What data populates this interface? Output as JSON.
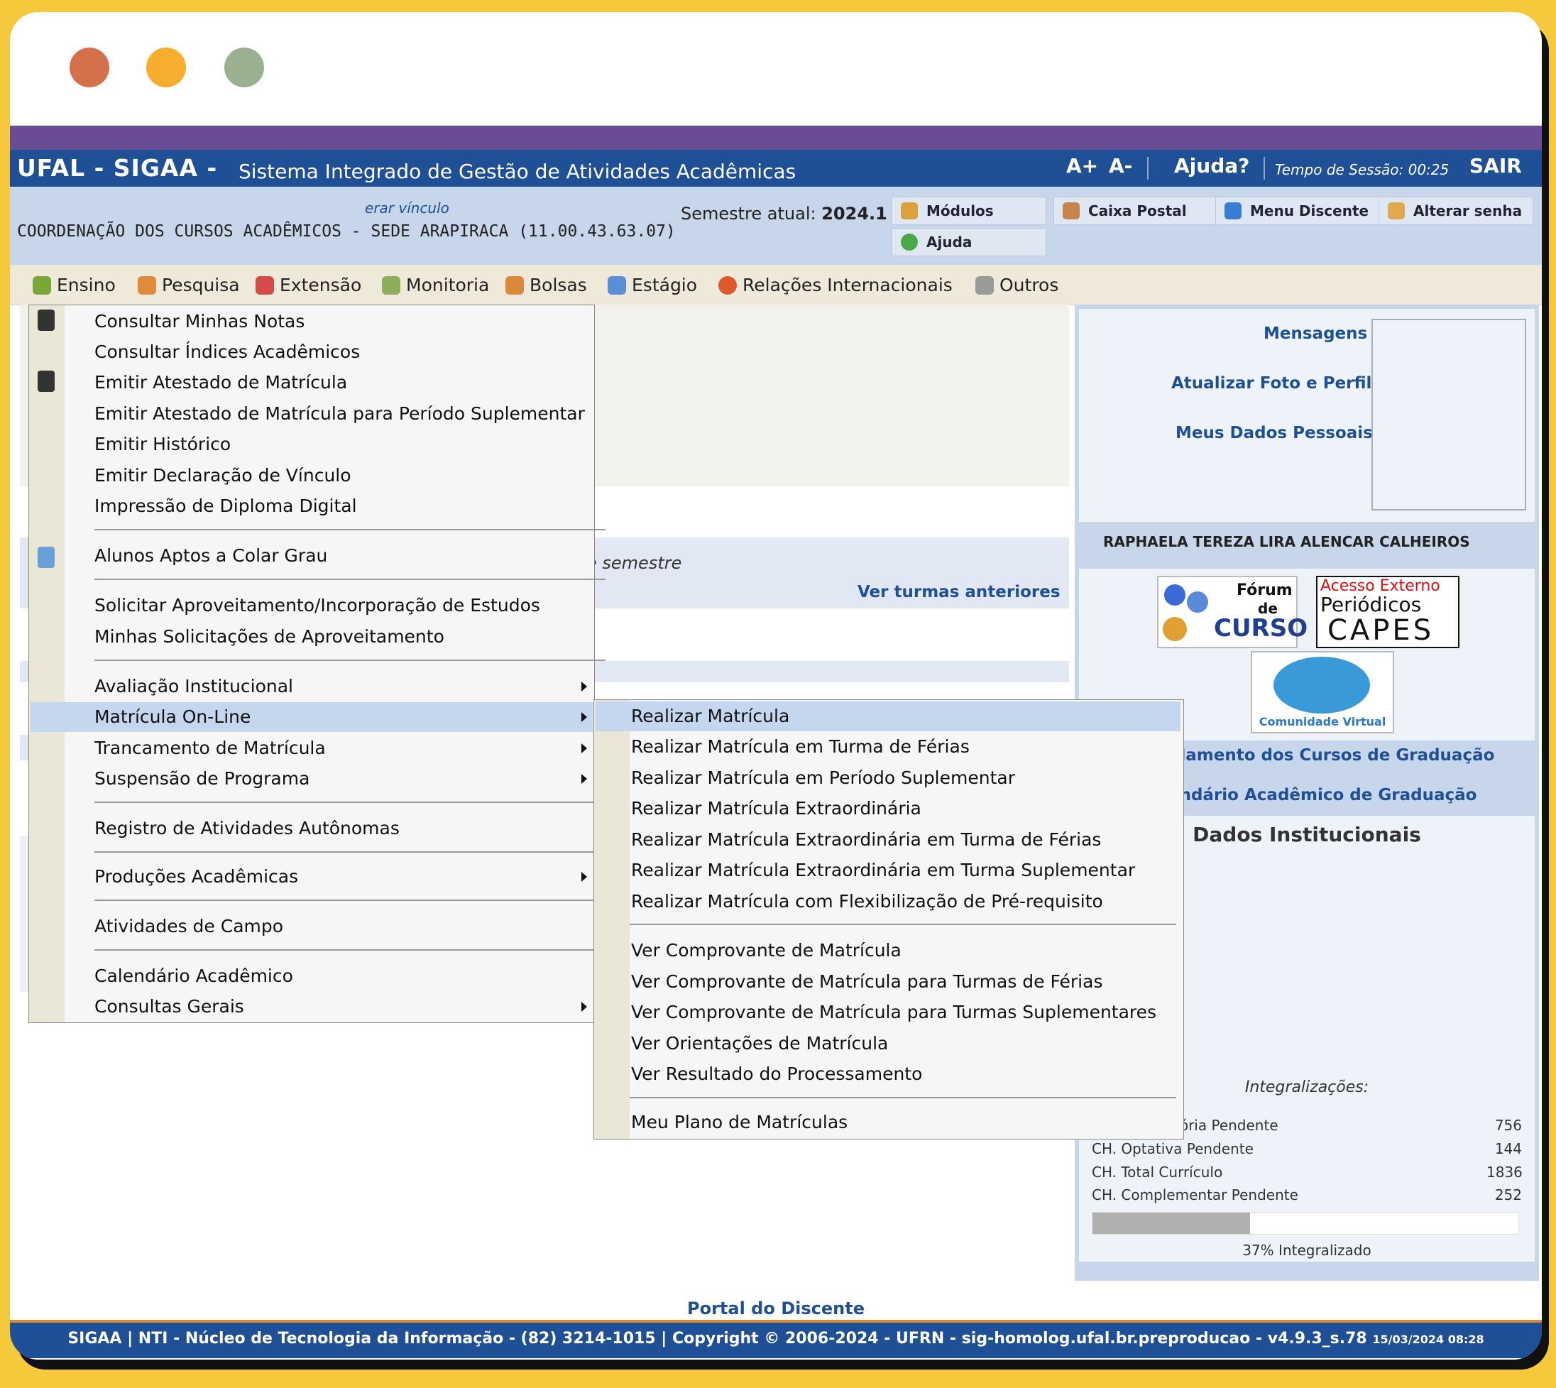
{
  "topbar": {
    "app": "UFAL - SIGAA -",
    "subtitle": "Sistema Integrado de Gestão de Atividades Acadêmicas",
    "font_up": "A+",
    "font_down": "A-",
    "help": "Ajuda?",
    "session": "Tempo de Sessão: 00:25",
    "logout": "SAIR"
  },
  "info": {
    "vinculo": "erar vínculo",
    "unit": "COORDENAÇÃO DOS CURSOS ACADÊMICOS - SEDE ARAPIRACA (11.00.43.63.07)",
    "semester_label": "Semestre atual:",
    "semester_value": "2024.1",
    "buttons": {
      "modulos": "Módulos",
      "caixa": "Caixa Postal",
      "menu_discente": "Menu Discente",
      "alterar": "Alterar senha",
      "ajuda": "Ajuda"
    }
  },
  "menubar": [
    "Ensino",
    "Pesquisa",
    "Extensão",
    "Monitoria",
    "Bolsas",
    "Estágio",
    "Relações Internacionais",
    "Outros"
  ],
  "dropdown": [
    "Consultar Minhas Notas",
    "Consultar Índices Acadêmicos",
    "Emitir Atestado de Matrícula",
    "Emitir Atestado de Matrícula para Período Suplementar",
    "Emitir Histórico",
    "Emitir Declaração de Vínculo",
    "Impressão de Diploma Digital",
    "Alunos Aptos a Colar Grau",
    "Solicitar Aproveitamento/Incorporação de Estudos",
    "Minhas Solicitações de Aproveitamento",
    "Avaliação Institucional",
    "Matrícula On-Line",
    "Trancamento de Matrícula",
    "Suspensão de Programa",
    "Registro de Atividades Autônomas",
    "Produções Acadêmicas",
    "Atividades de Campo",
    "Calendário Acadêmico",
    "Consultas Gerais"
  ],
  "submenu": [
    "Realizar Matrícula",
    "Realizar Matrícula em Turma de Férias",
    "Realizar Matrícula em Período Suplementar",
    "Realizar Matrícula Extraordinária",
    "Realizar Matrícula Extraordinária em Turma de Férias",
    "Realizar Matrícula Extraordinária em Turma Suplementar",
    "Realizar Matrícula com Flexibilização de Pré-requisito",
    "Ver Comprovante de Matrícula",
    "Ver Comprovante de Matrícula para Turmas de Férias",
    "Ver Comprovante de Matrícula para Turmas Suplementares",
    "Ver Orientações de Matrícula",
    "Ver Resultado do Processamento",
    "Meu Plano de Matrículas"
  ],
  "main": {
    "semestre_text": "e semestre",
    "ver_turmas": "Ver turmas anteriores"
  },
  "side": {
    "mensagens": "Mensagens",
    "atualizar": "Atualizar Foto e Perfil",
    "dados": "Meus Dados Pessoais",
    "name": "RAPHAELA TEREZA LIRA ALENCAR CALHEIROS",
    "forum_line1": "Fórum",
    "forum_line2": "de",
    "forum_line3": "CURSO",
    "capes_top": "Acesso Externo",
    "capes_mid": "Periódicos",
    "capes_bot": "CAPES",
    "comunidade": "Comunidade Virtual",
    "regulamento": "ulamento dos Cursos de Graduação",
    "calendario": "endário Acadêmico de Graduação",
    "dados_inst": "Dados Institucionais",
    "integralizacoes": "Integralizações:",
    "rows": [
      {
        "label": "tória Pendente",
        "value": "756"
      },
      {
        "label": "CH. Optativa Pendente",
        "value": "144"
      },
      {
        "label": "CH. Total Currículo",
        "value": "1836"
      },
      {
        "label": "CH. Complementar Pendente",
        "value": "252"
      }
    ],
    "progress_percent": 37,
    "progress_label": "37% Integralizado"
  },
  "footer": {
    "portal": "Portal do Discente",
    "text": "SIGAA | NTI - Núcleo de Tecnologia da Informação - (82) 3214-1015 | Copyright © 2006-2024 - UFRN - sig-homolog.ufal.br.preproducao - v4.9.3_s.78",
    "date": "15/03/2024 08:28"
  }
}
